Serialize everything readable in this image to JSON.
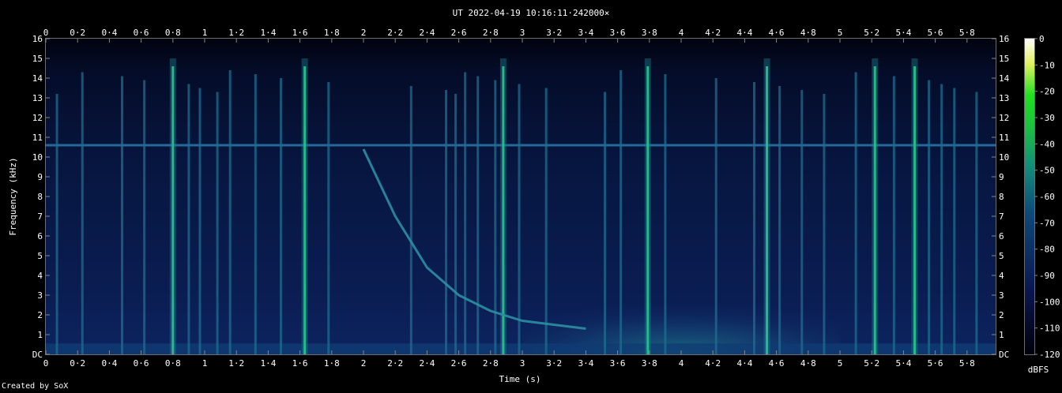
{
  "chart_data": {
    "type": "heatmap",
    "title": "UT 2022-04-19 10:16:11·242000×",
    "xlabel": "Time (s)",
    "ylabel": "Frequency (kHz)",
    "xlim": [
      0,
      5.98
    ],
    "ylim": [
      0,
      16
    ],
    "x_ticks": [
      "0",
      "0·2",
      "0·4",
      "0·6",
      "0·8",
      "1",
      "1·2",
      "1·4",
      "1·6",
      "1·8",
      "2",
      "2·2",
      "2·4",
      "2·6",
      "2·8",
      "3",
      "3·2",
      "3·4",
      "3·6",
      "3·8",
      "4",
      "4·2",
      "4·4",
      "4·6",
      "4·8",
      "5",
      "5·2",
      "5·4",
      "5·6",
      "5·8"
    ],
    "y_ticks": [
      "DC",
      "1",
      "2",
      "3",
      "4",
      "5",
      "6",
      "7",
      "8",
      "9",
      "10",
      "11",
      "12",
      "13",
      "14",
      "15",
      "16"
    ],
    "colorbar": {
      "label": "dBFS",
      "range": [
        -120,
        0
      ],
      "ticks": [
        "0",
        "-10",
        "-20",
        "-30",
        "-40",
        "-50",
        "-60",
        "-70",
        "-80",
        "-90",
        "-100",
        "-110",
        "-120"
      ]
    },
    "features": {
      "constant_tone_khz": 10.6,
      "whistler_sweep": [
        [
          2.0,
          10.4
        ],
        [
          2.2,
          7.0
        ],
        [
          2.4,
          4.4
        ],
        [
          2.6,
          3.0
        ],
        [
          2.8,
          2.2
        ],
        [
          3.0,
          1.7
        ],
        [
          3.4,
          1.3
        ]
      ],
      "strong_impulses_s": [
        0.8,
        1.63,
        2.88,
        3.79,
        4.54,
        5.22,
        5.47
      ],
      "impulses_s": [
        0.07,
        0.23,
        0.48,
        0.62,
        0.9,
        0.97,
        1.08,
        1.16,
        1.32,
        1.48,
        1.78,
        2.3,
        2.52,
        2.58,
        2.64,
        2.72,
        2.83,
        2.98,
        3.15,
        3.52,
        3.62,
        3.9,
        4.22,
        4.46,
        4.62,
        4.76,
        4.9,
        5.1,
        5.34,
        5.56,
        5.64,
        5.72,
        5.86
      ]
    }
  },
  "footer": {
    "credit": "Created by SoX"
  }
}
